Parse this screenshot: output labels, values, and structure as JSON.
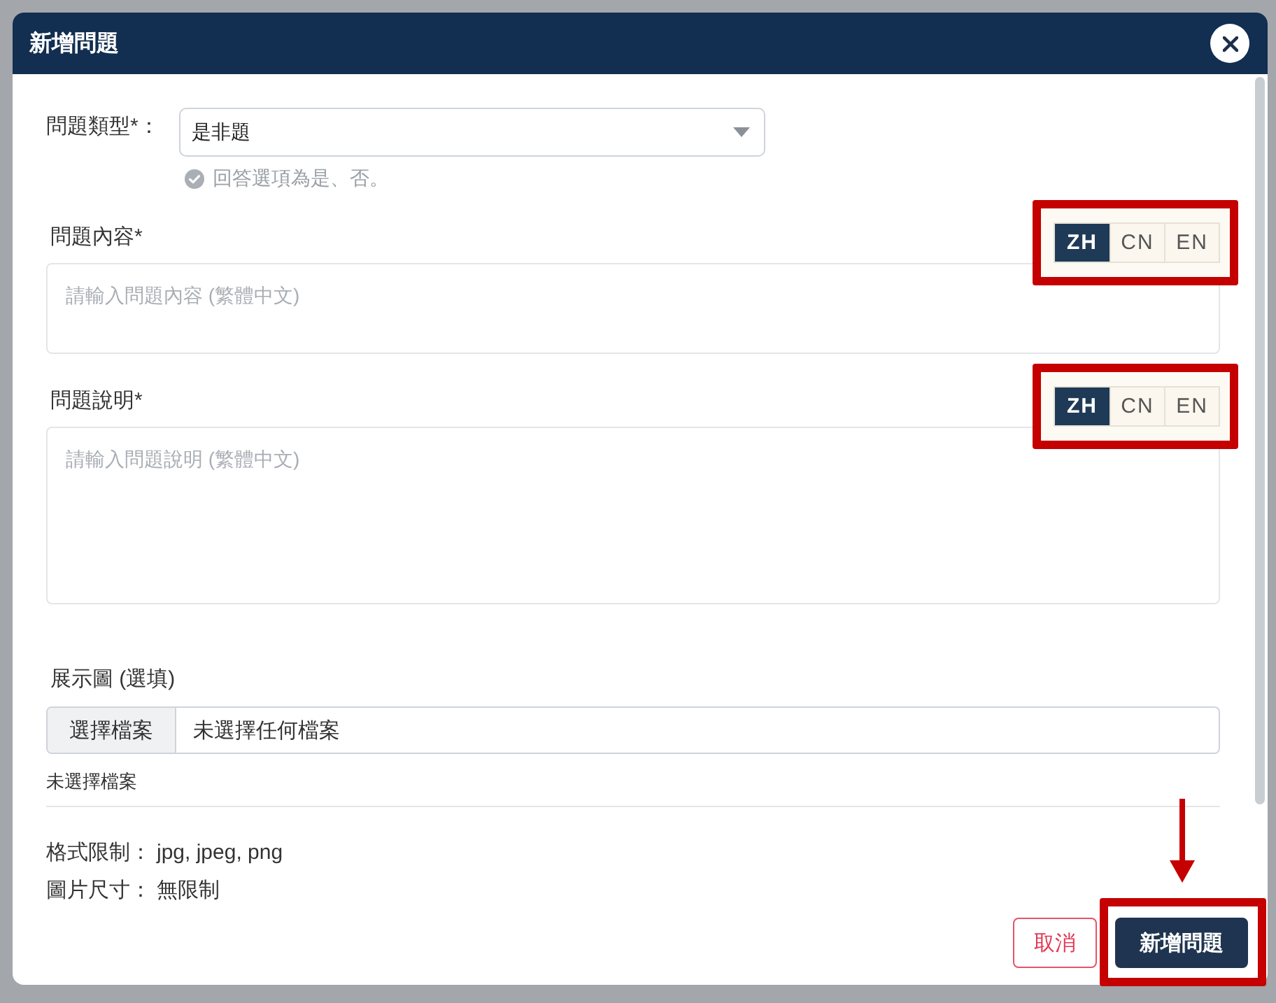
{
  "dialog": {
    "title": "新增問題"
  },
  "question_type": {
    "label": "問題類型*：",
    "value": "是非題",
    "hint": "回答選項為是、否。"
  },
  "text_fields": [
    {
      "label": "問題內容*",
      "highlighted": true,
      "languages": [
        {
          "label": "ZH",
          "selected": true
        },
        {
          "label": "CN",
          "selected": false
        },
        {
          "label": "EN",
          "selected": false
        }
      ],
      "placeholder": "請輸入問題內容 (繁體中文)"
    },
    {
      "label": "問題說明*",
      "highlighted": true,
      "languages": [
        {
          "label": "ZH",
          "selected": true
        },
        {
          "label": "CN",
          "selected": false
        },
        {
          "label": "EN",
          "selected": false
        }
      ],
      "placeholder": "請輸入問題說明 (繁體中文)"
    }
  ],
  "image_upload": {
    "label": "展示圖 (選填)",
    "button": "選擇檔案",
    "value": "未選擇任何檔案",
    "status": "未選擇檔案"
  },
  "requirements": [
    {
      "label": "格式限制：",
      "value": "jpg, jpeg, png"
    },
    {
      "label": "圖片尺寸：",
      "value": "無限制"
    }
  ],
  "buttons": [
    {
      "label": "取消",
      "kind": "secondary",
      "highlighted": false,
      "arrow": false
    },
    {
      "label": "新增問題",
      "kind": "primary",
      "highlighted": true,
      "arrow": true
    }
  ]
}
